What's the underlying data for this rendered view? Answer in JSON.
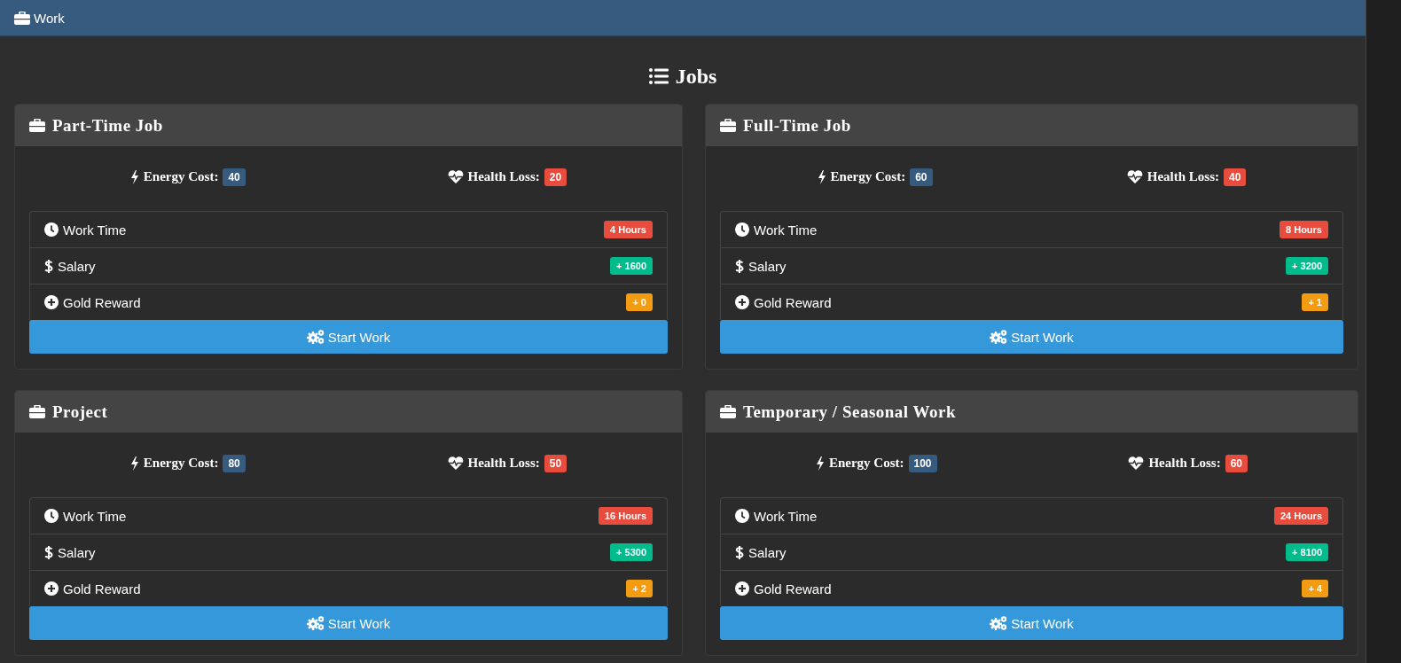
{
  "panel": {
    "title": "Work"
  },
  "heading": "Jobs",
  "jobs": [
    {
      "title": "Part-Time Job",
      "stats": [
        {
          "kind": "energy",
          "label": "Energy Cost:",
          "value": "40"
        },
        {
          "kind": "health",
          "label": "Health Loss:",
          "value": "20"
        }
      ],
      "rows": [
        {
          "kind": "time",
          "label": "Work Time",
          "value": "4 Hours"
        },
        {
          "kind": "salary",
          "label": "Salary",
          "value": "+ 1600"
        },
        {
          "kind": "gold",
          "label": "Gold Reward",
          "value": "+ 0"
        }
      ],
      "button": "Start Work"
    },
    {
      "title": "Full-Time Job",
      "stats": [
        {
          "kind": "energy",
          "label": "Energy Cost:",
          "value": "60"
        },
        {
          "kind": "health",
          "label": "Health Loss:",
          "value": "40"
        }
      ],
      "rows": [
        {
          "kind": "time",
          "label": "Work Time",
          "value": "8 Hours"
        },
        {
          "kind": "salary",
          "label": "Salary",
          "value": "+ 3200"
        },
        {
          "kind": "gold",
          "label": "Gold Reward",
          "value": "+ 1"
        }
      ],
      "button": "Start Work"
    },
    {
      "title": "Project",
      "stats": [
        {
          "kind": "energy",
          "label": "Energy Cost:",
          "value": "80"
        },
        {
          "kind": "health",
          "label": "Health Loss:",
          "value": "50"
        }
      ],
      "rows": [
        {
          "kind": "time",
          "label": "Work Time",
          "value": "16 Hours"
        },
        {
          "kind": "salary",
          "label": "Salary",
          "value": "+ 5300"
        },
        {
          "kind": "gold",
          "label": "Gold Reward",
          "value": "+ 2"
        }
      ],
      "button": "Start Work"
    },
    {
      "title": "Temporary / Seasonal Work",
      "stats": [
        {
          "kind": "energy",
          "label": "Energy Cost:",
          "value": "100"
        },
        {
          "kind": "health",
          "label": "Health Loss:",
          "value": "60"
        }
      ],
      "rows": [
        {
          "kind": "time",
          "label": "Work Time",
          "value": "24 Hours"
        },
        {
          "kind": "salary",
          "label": "Salary",
          "value": "+ 8100"
        },
        {
          "kind": "gold",
          "label": "Gold Reward",
          "value": "+ 4"
        }
      ],
      "button": "Start Work"
    }
  ]
}
